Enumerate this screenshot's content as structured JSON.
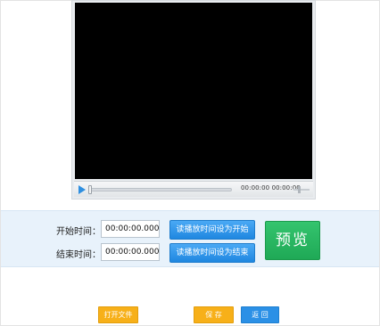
{
  "player": {
    "time_display": "00:00:00  00:00:00"
  },
  "form": {
    "start_label": "开始时间：",
    "start_value": "00:00:00.000",
    "end_label": "结束时间：",
    "end_value": "00:00:00.000",
    "set_start_button": "读播放时间设为开始",
    "set_end_button": "读播放时间设为结束",
    "preview_button": "预览"
  },
  "footer": {
    "open_file_button": "打开文件",
    "save_button": "保 存",
    "back_button": "返 回"
  },
  "colors": {
    "panel_bg": "#e8f2fb",
    "blue_button": "#1f87e0",
    "green_button": "#1fa956",
    "orange_button": "#f7b019"
  },
  "icons": [
    "play-icon",
    "volume-slider"
  ]
}
